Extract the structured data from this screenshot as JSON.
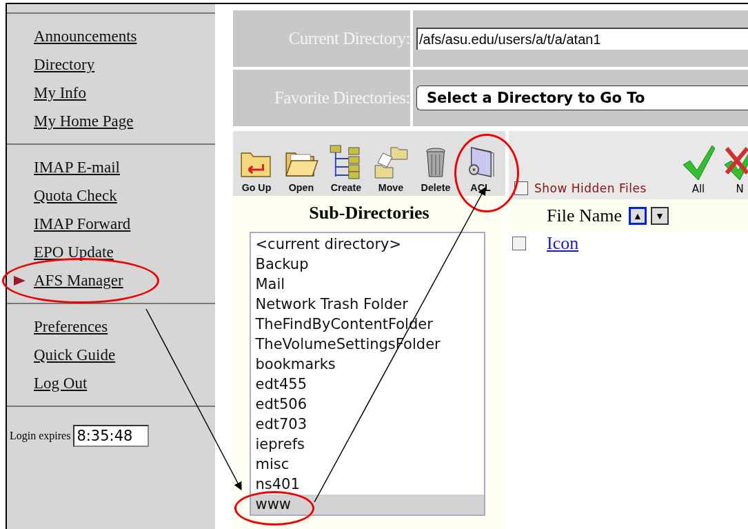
{
  "sidebar": {
    "groups": [
      {
        "items": [
          {
            "label": "Announcements",
            "current": false,
            "circled": false
          },
          {
            "label": "Directory",
            "current": false,
            "circled": false
          },
          {
            "label": "My Info",
            "current": false,
            "circled": false
          },
          {
            "label": "My Home Page",
            "current": false,
            "circled": false
          }
        ]
      },
      {
        "items": [
          {
            "label": "IMAP E-mail",
            "current": false,
            "circled": false
          },
          {
            "label": "Quota Check",
            "current": false,
            "circled": false
          },
          {
            "label": "IMAP Forward",
            "current": false,
            "circled": false
          },
          {
            "label": "EPO Update",
            "current": false,
            "circled": false
          },
          {
            "label": "AFS Manager",
            "current": true,
            "circled": true
          }
        ]
      },
      {
        "items": [
          {
            "label": "Preferences",
            "current": false,
            "circled": false
          },
          {
            "label": "Quick Guide",
            "current": false,
            "circled": false
          },
          {
            "label": "Log Out",
            "current": false,
            "circled": false
          }
        ]
      }
    ],
    "login": {
      "label": "Login expires",
      "value": "8:35:48"
    }
  },
  "current_directory": {
    "label": "Current Directory:",
    "value": "/afs/asu.edu/users/a/t/a/atan1"
  },
  "favorite_directories": {
    "label": "Favorite Directories:",
    "value": "Select a Directory to Go To"
  },
  "toolbar": [
    {
      "label": "Go Up",
      "kind": "go-up",
      "circled": false
    },
    {
      "label": "Open",
      "kind": "open",
      "circled": false
    },
    {
      "label": "Create",
      "kind": "create",
      "circled": false
    },
    {
      "label": "Move",
      "kind": "move",
      "circled": false
    },
    {
      "label": "Delete",
      "kind": "delete",
      "circled": false
    },
    {
      "label": "ACL",
      "kind": "acl",
      "circled": true
    }
  ],
  "show_hidden": {
    "label": "Show Hidden Files",
    "checked": false
  },
  "select_buttons": [
    {
      "label": "All",
      "kind": "check"
    },
    {
      "label": "N",
      "kind": "cross"
    }
  ],
  "subdirectories": {
    "title": "Sub-Directories",
    "items": [
      {
        "label": "<current directory>",
        "selected": false,
        "circled": false
      },
      {
        "label": "Backup",
        "selected": false,
        "circled": false
      },
      {
        "label": "Mail",
        "selected": false,
        "circled": false
      },
      {
        "label": "Network Trash Folder",
        "selected": false,
        "circled": false
      },
      {
        "label": "TheFindByContentFolder",
        "selected": false,
        "circled": false
      },
      {
        "label": "TheVolumeSettingsFolder",
        "selected": false,
        "circled": false
      },
      {
        "label": "bookmarks",
        "selected": false,
        "circled": false
      },
      {
        "label": "edt455",
        "selected": false,
        "circled": false
      },
      {
        "label": "edt506",
        "selected": false,
        "circled": false
      },
      {
        "label": "edt703",
        "selected": false,
        "circled": false
      },
      {
        "label": "ieprefs",
        "selected": false,
        "circled": false
      },
      {
        "label": "misc",
        "selected": false,
        "circled": false
      },
      {
        "label": "ns401",
        "selected": false,
        "circled": false
      },
      {
        "label": "www",
        "selected": true,
        "circled": true
      }
    ]
  },
  "files": {
    "column": "File Name",
    "sort_buttons": [
      {
        "label": "▲",
        "selected": true
      },
      {
        "label": "▼",
        "selected": false
      }
    ],
    "rows": [
      {
        "name": "Icon",
        "checked": false
      }
    ]
  }
}
